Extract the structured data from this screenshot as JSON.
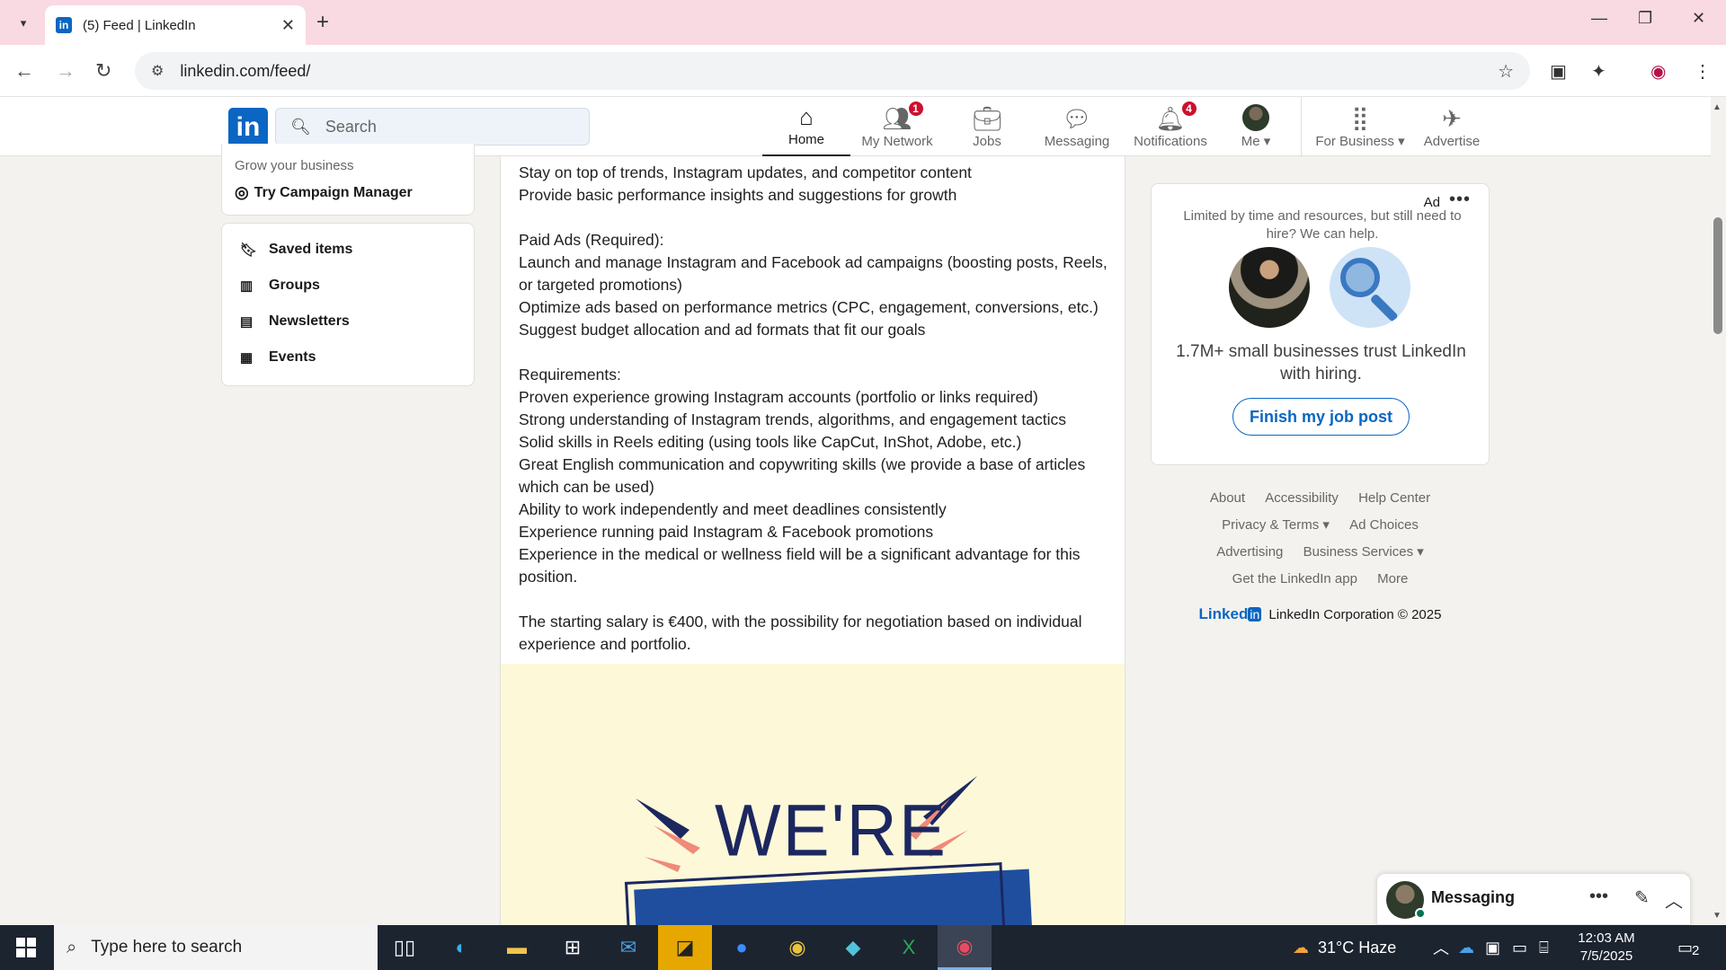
{
  "browser": {
    "tab_title": "(5) Feed | LinkedIn",
    "url": "linkedin.com/feed/"
  },
  "header": {
    "search_placeholder": "Search",
    "nav": [
      {
        "label": "Home",
        "icon": "home-icon",
        "active": true
      },
      {
        "label": "My Network",
        "icon": "network-icon",
        "badge": "1"
      },
      {
        "label": "Jobs",
        "icon": "briefcase-icon"
      },
      {
        "label": "Messaging",
        "icon": "messaging-icon"
      },
      {
        "label": "Notifications",
        "icon": "bell-icon",
        "badge": "4"
      },
      {
        "label": "Me",
        "icon": "avatar"
      },
      {
        "label": "For Business",
        "icon": "grid-icon"
      },
      {
        "label": "Advertise",
        "icon": "advertise-icon"
      }
    ]
  },
  "left_rail": {
    "grow_text": "Grow your business",
    "campaign_label": "Try Campaign Manager",
    "links": [
      "Saved items",
      "Groups",
      "Newsletters",
      "Events"
    ]
  },
  "post": {
    "lines": [
      "Stay on top of trends, Instagram updates, and competitor content",
      "Provide basic performance insights and suggestions for growth",
      "",
      "Paid Ads (Required):",
      "Launch and manage Instagram and Facebook ad campaigns (boosting posts, Reels, or targeted promotions)",
      "Optimize ads based on performance metrics (CPC, engagement, conversions, etc.)",
      "Suggest budget allocation and ad formats that fit our goals",
      "",
      "Requirements:",
      "Proven experience growing Instagram accounts (portfolio or links required)",
      "Strong understanding of Instagram trends, algorithms, and engagement tactics",
      "Solid skills in Reels editing (using tools like CapCut, InShot, Adobe, etc.)",
      "Great English communication and copywriting skills (we provide a base of articles which can be used)",
      "Ability to work independently and meet deadlines consistently",
      "Experience running paid Instagram & Facebook promotions",
      "Experience in the medical or wellness field will be a significant advantage for this position.",
      "",
      "The starting salary is €400, with the possibility for negotiation based on individual experience and portfolio."
    ],
    "image_text": "WE'RE"
  },
  "ad": {
    "label": "Ad",
    "copy": "Limited by time and resources, but still need to hire? We can help.",
    "headline": "1.7M+ small businesses trust LinkedIn with hiring.",
    "cta": "Finish my job post"
  },
  "footer": {
    "rows": [
      [
        "About",
        "Accessibility",
        "Help Center"
      ],
      [
        "Privacy & Terms ▾",
        "Ad Choices"
      ],
      [
        "Advertising",
        "Business Services ▾"
      ],
      [
        "Get the LinkedIn app",
        "More"
      ]
    ],
    "brand_wordmark": "Linked",
    "brand_box": "in",
    "copyright": "LinkedIn Corporation © 2025"
  },
  "messaging": {
    "title": "Messaging"
  },
  "taskbar": {
    "search_placeholder": "Type here to search",
    "weather": "31°C  Haze",
    "time": "12:03 AM",
    "date": "7/5/2025",
    "notification_count": "2"
  },
  "colors": {
    "accent": "#0a66c2",
    "badge": "#cb112d",
    "tabbar": "#f9d9e2",
    "post_image_bg": "#fdf9d8"
  }
}
